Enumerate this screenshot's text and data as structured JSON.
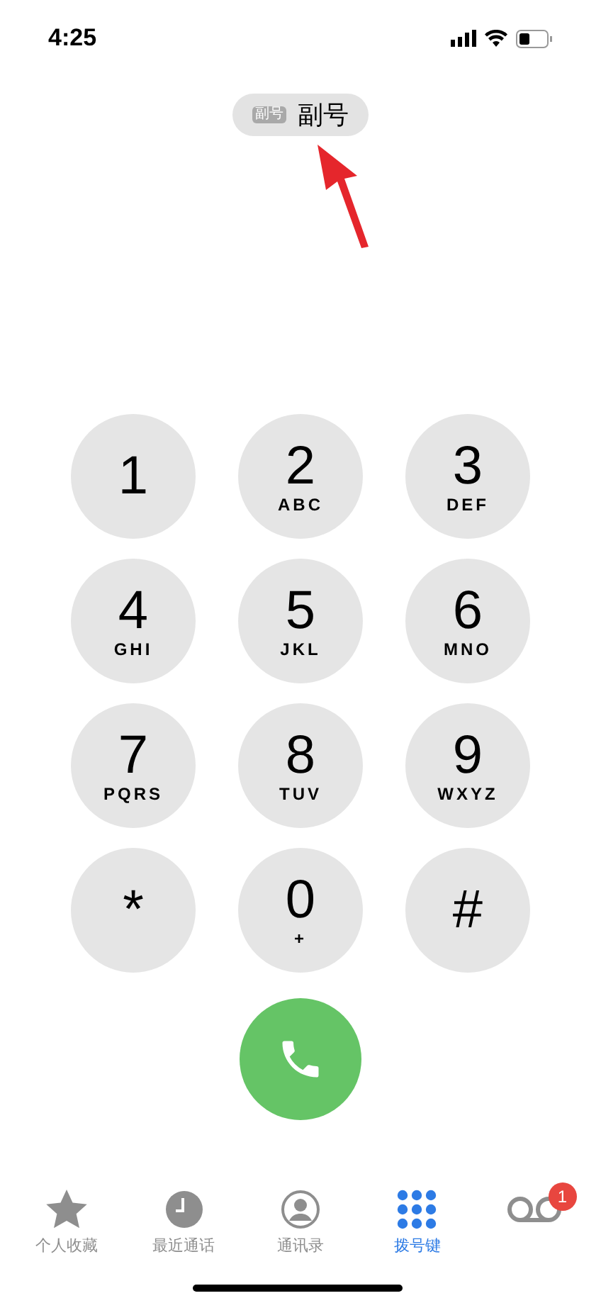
{
  "status_bar": {
    "time": "4:25"
  },
  "line_selector": {
    "badge": "副号",
    "label": "副号"
  },
  "keypad": [
    {
      "digit": "1"
    },
    {
      "digit": "2",
      "letters": "ABC"
    },
    {
      "digit": "3",
      "letters": "DEF"
    },
    {
      "digit": "4",
      "letters": "GHI"
    },
    {
      "digit": "5",
      "letters": "JKL"
    },
    {
      "digit": "6",
      "letters": "MNO"
    },
    {
      "digit": "7",
      "letters": "PQRS"
    },
    {
      "digit": "8",
      "letters": "TUV"
    },
    {
      "digit": "9",
      "letters": "WXYZ"
    },
    {
      "digit": "*"
    },
    {
      "digit": "0",
      "letters": "+"
    },
    {
      "digit": "#"
    }
  ],
  "tabs": [
    {
      "kind": "star",
      "label": "个人收藏",
      "selected": false
    },
    {
      "kind": "clock",
      "label": "最近通话",
      "selected": false
    },
    {
      "kind": "person",
      "label": "通讯录",
      "selected": false
    },
    {
      "kind": "grid",
      "label": "拨号键",
      "selected": true
    },
    {
      "kind": "voicemail",
      "badge": "1",
      "selected": false
    }
  ]
}
